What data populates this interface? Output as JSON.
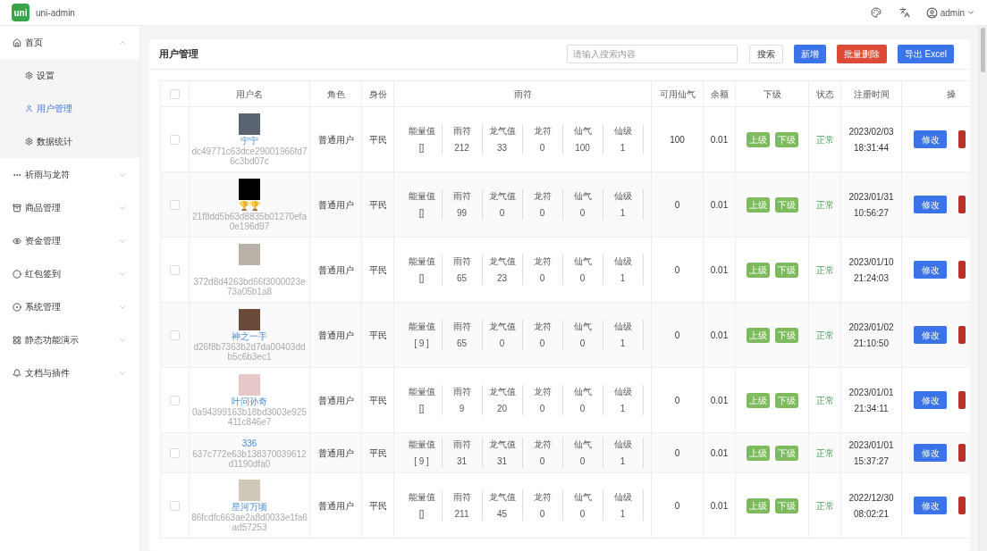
{
  "app": {
    "name": "uni-admin",
    "logo": "uni"
  },
  "header": {
    "user": "admin"
  },
  "sidebar": {
    "items": [
      {
        "label": "首页",
        "expanded": true,
        "children": [
          {
            "label": "设置",
            "selected": false
          },
          {
            "label": "用户管理",
            "selected": true
          },
          {
            "label": "数据统计",
            "selected": false
          }
        ]
      },
      {
        "label": "祈雨与龙符",
        "expanded": false
      },
      {
        "label": "商品管理",
        "expanded": false
      },
      {
        "label": "资金管理",
        "expanded": false
      },
      {
        "label": "红包签到",
        "expanded": false
      },
      {
        "label": "系统管理",
        "expanded": false
      },
      {
        "label": "静态功能演示",
        "expanded": false
      },
      {
        "label": "文档与插件",
        "expanded": false
      }
    ]
  },
  "page": {
    "title": "用户管理",
    "search": {
      "placeholder": "请输入搜索内容"
    },
    "buttons": [
      {
        "label": "搜索",
        "kind": "plain"
      },
      {
        "label": "新增",
        "kind": "primary"
      },
      {
        "label": "批量删除",
        "kind": "danger"
      },
      {
        "label": "导出 Excel",
        "kind": "primary"
      }
    ]
  },
  "table": {
    "select_all_checked": false,
    "columns": [
      "用户名",
      "角色",
      "身份",
      "雨符",
      "可用仙气",
      "余额",
      "下级",
      "状态",
      "注册时间",
      "操"
    ],
    "rows": [
      {
        "checked": false,
        "avatar": true,
        "name": "宁宁",
        "id": "dc49771c63dce29001966fd76c3bd07c",
        "role": "普通用户",
        "rank": "平民",
        "stats": [
          {
            "label": "能量值",
            "value": "[]"
          },
          {
            "label": "雨符",
            "value": "212"
          },
          {
            "label": "龙气值",
            "value": "33"
          },
          {
            "label": "龙符",
            "value": "0"
          },
          {
            "label": "仙气",
            "value": "100"
          },
          {
            "label": "仙级",
            "value": "1"
          }
        ],
        "spirit": "100",
        "balance": "0.01",
        "links": [
          "上级",
          "下级"
        ],
        "status": "正常",
        "date": "2023/02/03",
        "time": "18:31:44",
        "action": "修改"
      },
      {
        "checked": false,
        "avatar": true,
        "name": "🏆🏆",
        "id": "21f8dd5b63d8835b01270efa0e196d97",
        "role": "普通用户",
        "rank": "平民",
        "stats": [
          {
            "label": "能量值",
            "value": "[]"
          },
          {
            "label": "雨符",
            "value": "99"
          },
          {
            "label": "龙气值",
            "value": "0"
          },
          {
            "label": "龙符",
            "value": "0"
          },
          {
            "label": "仙气",
            "value": "0"
          },
          {
            "label": "仙级",
            "value": "1"
          }
        ],
        "spirit": "0",
        "balance": "0.01",
        "links": [
          "上级",
          "下级"
        ],
        "status": "正常",
        "date": "2023/01/31",
        "time": "10:56:27",
        "action": "修改"
      },
      {
        "checked": false,
        "avatar": true,
        "id": "372d8d4263bd66f3000023e73a05b1a8",
        "role": "普通用户",
        "rank": "平民",
        "stats": [
          {
            "label": "能量值",
            "value": "[]"
          },
          {
            "label": "雨符",
            "value": "65"
          },
          {
            "label": "龙气值",
            "value": "23"
          },
          {
            "label": "龙符",
            "value": "0"
          },
          {
            "label": "仙气",
            "value": "0"
          },
          {
            "label": "仙级",
            "value": "1"
          }
        ],
        "spirit": "0",
        "balance": "0.01",
        "links": [
          "上级",
          "下级"
        ],
        "status": "正常",
        "date": "2023/01/10",
        "time": "21:24:03",
        "action": "修改"
      },
      {
        "checked": false,
        "avatar": true,
        "name": "神之一手",
        "id": "d26f8b7363b2d7da00403ddb5c6b3ec1",
        "role": "普通用户",
        "rank": "平民",
        "stats": [
          {
            "label": "能量值",
            "value": "[ 9 ]"
          },
          {
            "label": "雨符",
            "value": "65"
          },
          {
            "label": "龙气值",
            "value": "0"
          },
          {
            "label": "龙符",
            "value": "0"
          },
          {
            "label": "仙气",
            "value": "0"
          },
          {
            "label": "仙级",
            "value": "1"
          }
        ],
        "spirit": "0",
        "balance": "0.01",
        "links": [
          "上级",
          "下级"
        ],
        "status": "正常",
        "date": "2023/01/02",
        "time": "21:10:50",
        "action": "修改"
      },
      {
        "checked": false,
        "avatar": true,
        "name": "叶问孙奇",
        "id": "0a94399163b18bd3003e925411c846e7",
        "role": "普通用户",
        "rank": "平民",
        "stats": [
          {
            "label": "能量值",
            "value": "[]"
          },
          {
            "label": "雨符",
            "value": "9"
          },
          {
            "label": "龙气值",
            "value": "20"
          },
          {
            "label": "龙符",
            "value": "0"
          },
          {
            "label": "仙气",
            "value": "0"
          },
          {
            "label": "仙级",
            "value": "1"
          }
        ],
        "spirit": "0",
        "balance": "0.01",
        "links": [
          "上级",
          "下级"
        ],
        "status": "正常",
        "date": "2023/01/01",
        "time": "21:34:11",
        "action": "修改"
      },
      {
        "checked": false,
        "avatar": false,
        "name": "336",
        "id": "637c772e63b138370039612d1190dfa0",
        "role": "普通用户",
        "rank": "平民",
        "stats": [
          {
            "label": "能量值",
            "value": "[ 9 ]"
          },
          {
            "label": "雨符",
            "value": "31"
          },
          {
            "label": "龙气值",
            "value": "31"
          },
          {
            "label": "龙符",
            "value": "0"
          },
          {
            "label": "仙气",
            "value": "0"
          },
          {
            "label": "仙级",
            "value": "1"
          }
        ],
        "spirit": "0",
        "balance": "0.01",
        "links": [
          "上级",
          "下级"
        ],
        "status": "正常",
        "date": "2023/01/01",
        "time": "15:37:27",
        "action": "修改"
      },
      {
        "checked": false,
        "avatar": true,
        "name": "星河万顷",
        "id": "86fcdfc663ae2a8d0033e1fa6ad57253",
        "role": "普通用户",
        "rank": "平民",
        "stats": [
          {
            "label": "能量值",
            "value": "[]"
          },
          {
            "label": "雨符",
            "value": "211"
          },
          {
            "label": "龙气值",
            "value": "45"
          },
          {
            "label": "龙符",
            "value": "0"
          },
          {
            "label": "仙气",
            "value": "0"
          },
          {
            "label": "仙级",
            "value": "1"
          }
        ],
        "spirit": "0",
        "balance": "0.01",
        "links": [
          "上级",
          "下级"
        ],
        "status": "正常",
        "date": "2022/12/30",
        "time": "08:02:21",
        "action": "修改"
      }
    ]
  }
}
